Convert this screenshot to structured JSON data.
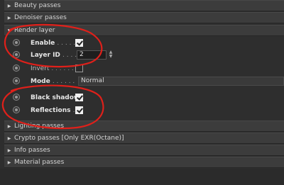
{
  "sections": {
    "beauty": "Beauty passes",
    "denoiser": "Denoiser passes",
    "render_layer": "Render layer",
    "lighting": "Lighting passes",
    "crypto": "Crypto passes [Only EXR(Octane)]",
    "info": "Info passes",
    "material": "Material passes"
  },
  "render_layer": {
    "enable_label": "Enable",
    "enable_dots": ". . . . .",
    "enable_checked": true,
    "layer_id_label": "Layer ID",
    "layer_id_dots": ". . . .",
    "layer_id_value": "2",
    "invert_label": "Invert",
    "invert_dots": ". . . . . .",
    "invert_checked": false,
    "mode_label": "Mode",
    "mode_dots": ". . . . . .",
    "mode_value": "Normal",
    "black_shadows_label": "Black shadows",
    "black_shadows_checked": true,
    "reflections_label": "Reflections",
    "reflections_dots": ". .",
    "reflections_checked": true
  },
  "icons": {
    "collapsed": "triangle-right-icon",
    "expanded": "triangle-down-icon",
    "radio": "animation-radio-icon",
    "spinner": "spinner-arrows-icon"
  },
  "colors": {
    "annotation": "#e0201a",
    "panel_bg": "#2e2e2e",
    "header_bg": "#3c3c3c"
  }
}
